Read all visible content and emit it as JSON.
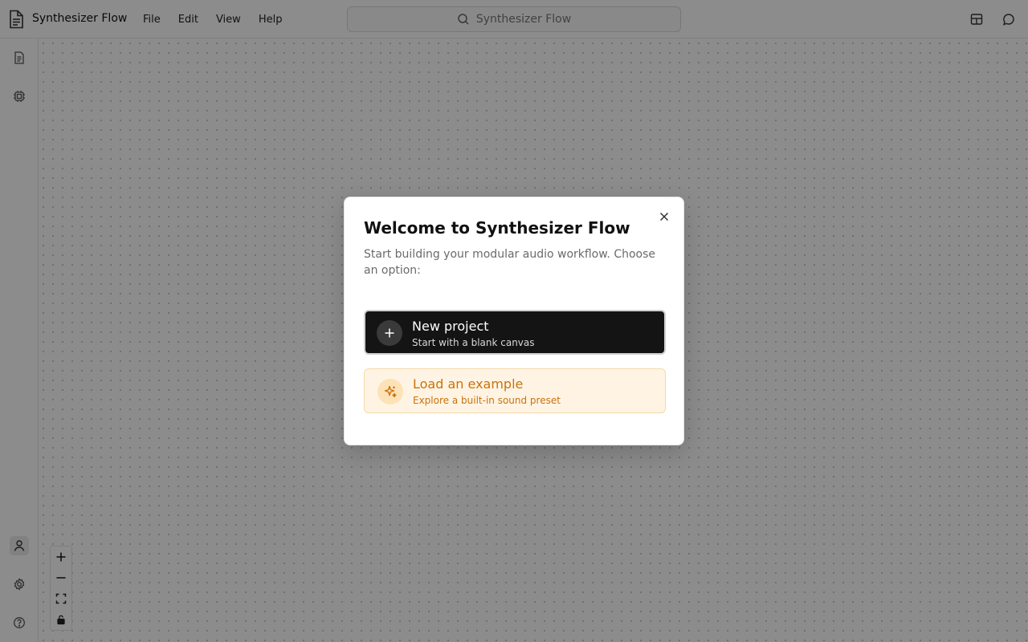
{
  "app": {
    "title": "Synthesizer Flow"
  },
  "menu": {
    "items": [
      "File",
      "Edit",
      "View",
      "Help"
    ]
  },
  "search": {
    "text": "Synthesizer Flow"
  },
  "topbar_right": {
    "icons": [
      "layout-icon",
      "chat-icon"
    ]
  },
  "rail": {
    "top_icons": [
      "document-icon",
      "chip-icon"
    ],
    "bottom_icons": [
      "user-icon",
      "settings-icon",
      "help-icon"
    ]
  },
  "zoom_controls": {
    "icons": [
      "zoom-in-icon",
      "zoom-out-icon",
      "fit-view-icon",
      "lock-icon"
    ]
  },
  "dialog": {
    "title": "Welcome to Synthesizer Flow",
    "description": "Start building your modular audio workflow. Choose an option:",
    "options": [
      {
        "title": "New project",
        "subtitle": "Start with a blank canvas",
        "icon": "plus-icon"
      },
      {
        "title": "Load an example",
        "subtitle": "Explore a built-in sound preset",
        "icon": "sparkle-icon"
      }
    ]
  },
  "colors": {
    "accent_orange": "#c9720c",
    "primary_dark": "#141414",
    "orange_bg": "#fff4e3"
  }
}
